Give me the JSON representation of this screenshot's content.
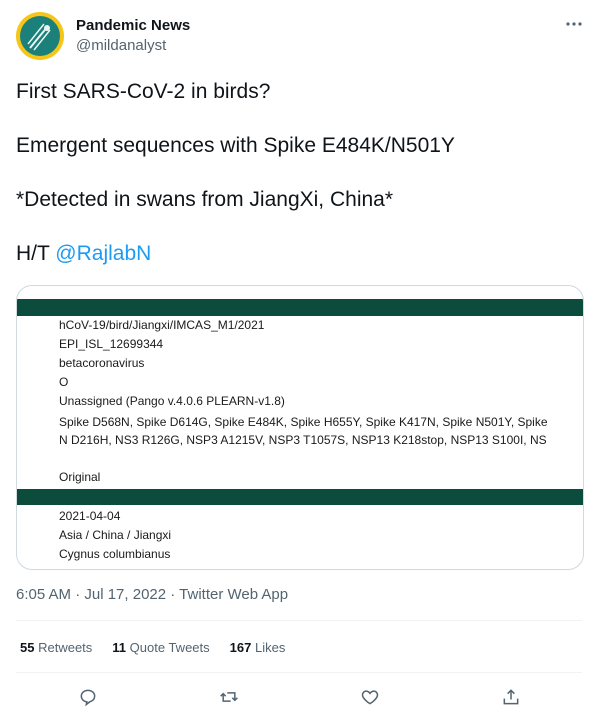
{
  "tweet": {
    "author_name": "Pandemic News",
    "author_handle": "@mildanalyst",
    "lines": [
      "First SARS-CoV-2 in birds?",
      "Emergent sequences with Spike E484K/N501Y",
      "*Detected in swans from JiangXi, China*"
    ],
    "ht_prefix": "H/T ",
    "ht_mention": "@RajlabN",
    "timestamp": "6:05 AM · Jul 17, 2022 · Twitter Web App"
  },
  "media": {
    "lines_top": [
      "hCoV-19/bird/Jiangxi/IMCAS_M1/2021",
      "EPI_ISL_12699344",
      "betacoronavirus",
      "O",
      "Unassigned (Pango v.4.0.6 PLEARN-v1.8)",
      "Spike D568N, Spike D614G, Spike E484K, Spike H655Y, Spike K417N, Spike N501Y, Spike",
      "N D216H, NS3 R126G, NSP3 A1215V, NSP3 T1057S, NSP13 K218stop, NSP13 S100I, NS"
    ],
    "original_label": "Original",
    "lines_bottom": [
      "2021-04-04",
      "Asia / China / Jiangxi",
      "Cygnus columbianus"
    ]
  },
  "stats": {
    "retweets_count": "55",
    "retweets_label": "Retweets",
    "quotes_count": "11",
    "quotes_label": "Quote Tweets",
    "likes_count": "167",
    "likes_label": "Likes"
  },
  "icons": {
    "more": "more-horizontal-icon",
    "reply": "reply-icon",
    "retweet": "retweet-icon",
    "like": "heart-icon",
    "share": "share-icon"
  },
  "colors": {
    "accent": "#1d9bf0",
    "table_bar": "#0c4c3c",
    "text_secondary": "#536471"
  }
}
